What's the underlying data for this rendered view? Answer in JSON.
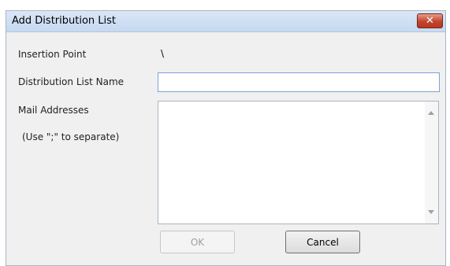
{
  "window": {
    "title": "Add Distribution List",
    "close_glyph": "✕"
  },
  "form": {
    "insertion_point_label": "Insertion Point",
    "insertion_point_value": "\\",
    "name_label": "Distribution List Name",
    "name_value": "",
    "mail_label": "Mail Addresses",
    "mail_hint": "(Use \";\" to separate)",
    "mail_value": ""
  },
  "buttons": {
    "ok": "OK",
    "cancel": "Cancel"
  }
}
